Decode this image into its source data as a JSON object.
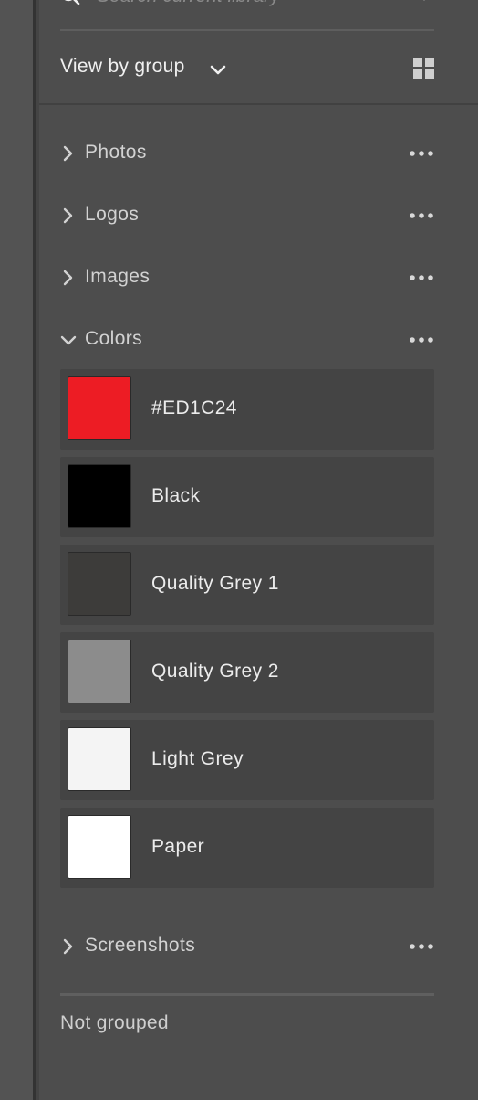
{
  "search": {
    "placeholder": "Search current library",
    "icon": "search-icon",
    "dropdown_icon": "chevron-down-icon"
  },
  "view": {
    "label": "View by group",
    "dropdown_icon": "chevron-down-icon",
    "layout_toggle_icon": "grid-view-icon"
  },
  "groups": [
    {
      "label": "Photos",
      "expanded": false
    },
    {
      "label": "Logos",
      "expanded": false
    },
    {
      "label": "Images",
      "expanded": false
    },
    {
      "label": "Colors",
      "expanded": true
    },
    {
      "label": "Screenshots",
      "expanded": false
    }
  ],
  "colors": [
    {
      "name": "#ED1C24",
      "swatch": "#ED1C24"
    },
    {
      "name": "Black",
      "swatch": "#000000"
    },
    {
      "name": "Quality Grey 1",
      "swatch": "#3D3C3A"
    },
    {
      "name": "Quality Grey 2",
      "swatch": "#8C8C8C"
    },
    {
      "name": "Light Grey",
      "swatch": "#F4F4F4"
    },
    {
      "name": "Paper",
      "swatch": "#FFFFFF"
    }
  ],
  "footer": {
    "label": "Not grouped"
  }
}
